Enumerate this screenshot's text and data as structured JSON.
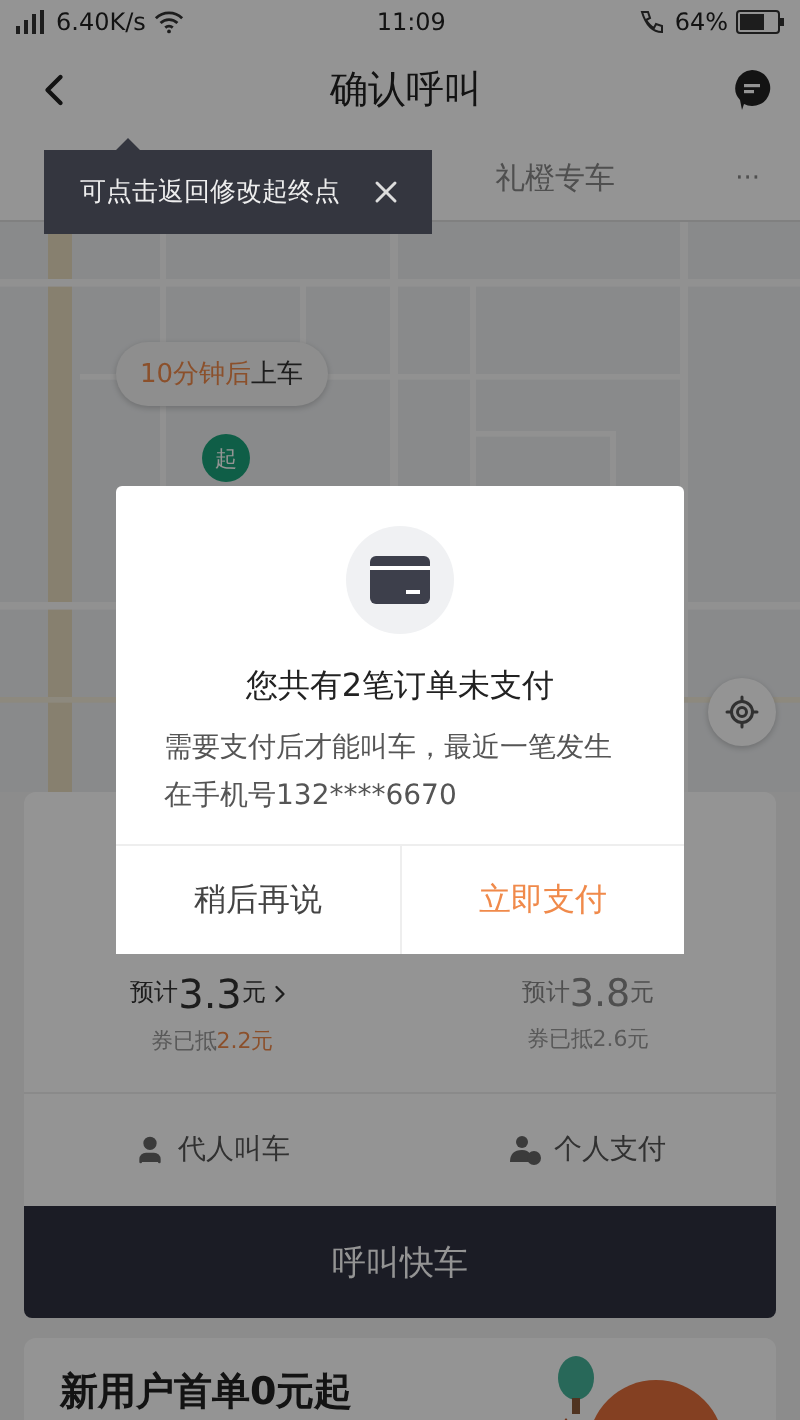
{
  "status_bar": {
    "network_speed": "6.40K/s",
    "time": "11:09",
    "battery": "64%"
  },
  "header": {
    "title": "确认呼叫"
  },
  "tooltip": {
    "text": "可点击返回修改起终点"
  },
  "tabs": [
    {
      "label": "礼橙专车",
      "kind": "text"
    },
    {
      "label": "···",
      "kind": "more"
    }
  ],
  "map": {
    "eta": "10分钟后",
    "eta_suffix": "上车",
    "pin": "起"
  },
  "fare_options": [
    {
      "selected": true,
      "prefix": "预计",
      "price": "3.3",
      "unit": "元",
      "coupon_prefix": "券已抵",
      "coupon_amount": "2.2元"
    },
    {
      "selected": false,
      "prefix": "预计",
      "price": "3.8",
      "unit": "元",
      "coupon_prefix": "券已抵",
      "coupon_amount": "2.6元"
    }
  ],
  "actions": [
    {
      "label": "代人叫车",
      "kind": "person"
    },
    {
      "label": "个人支付",
      "kind": "pay"
    }
  ],
  "call_button": "呼叫快车",
  "promo": {
    "title": "新用户首单0元起"
  },
  "dialog": {
    "title": "您共有2笔订单未支付",
    "message": "需要支付后才能叫车，最近一笔发生在手机号132****6670",
    "buttons": [
      {
        "label": "稍后再说",
        "kind": "secondary"
      },
      {
        "label": "立即支付",
        "kind": "primary"
      }
    ]
  }
}
